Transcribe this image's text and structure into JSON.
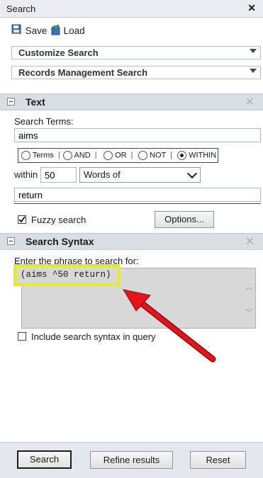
{
  "window": {
    "title": "Search",
    "close": "✕"
  },
  "toolbar": {
    "save_label": "Save",
    "load_label": "Load"
  },
  "dropdowns": [
    {
      "label": "Customize Search"
    },
    {
      "label": "Records Management Search"
    }
  ],
  "text_section": {
    "title": "Text",
    "close": "✕",
    "search_terms_label": "Search Terms:",
    "search_terms_value": "aims",
    "operators": [
      {
        "label": "Terms",
        "selected": false
      },
      {
        "label": "AND",
        "selected": false
      },
      {
        "label": "OR",
        "selected": false
      },
      {
        "label": "NOT",
        "selected": false
      },
      {
        "label": "WITHIN",
        "selected": true
      }
    ],
    "separator": "|",
    "within_label": "within",
    "within_value": "50",
    "unit_select": "Words of",
    "second_term_value": "return",
    "fuzzy_label": "Fuzzy search",
    "fuzzy_checked": true,
    "options_button": "Options..."
  },
  "syntax_section": {
    "title": "Search Syntax",
    "close": "✕",
    "prompt": "Enter the phrase to search for:",
    "syntax_value": "(aims ^50 return)",
    "include_label": "Include search syntax in query",
    "include_checked": false
  },
  "footer": {
    "search_button": "Search",
    "refine_button": "Refine results",
    "reset_button": "Reset"
  },
  "colors": {
    "highlight_border": "#e8ec1e",
    "arrow": "#e4141a"
  }
}
